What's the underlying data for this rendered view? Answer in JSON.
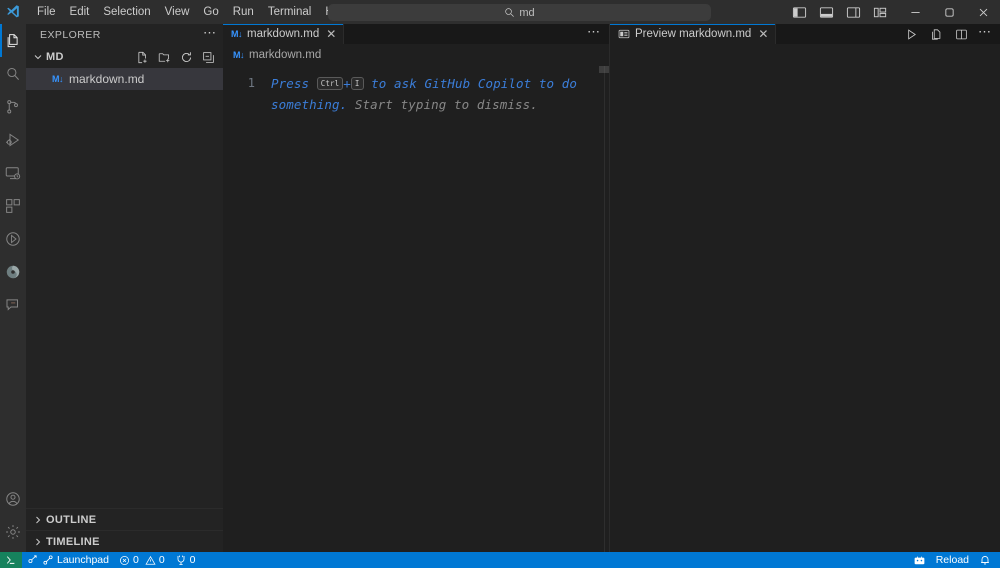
{
  "titlebar": {
    "logo_name": "vscode-logo",
    "menus": [
      "File",
      "Edit",
      "Selection",
      "View",
      "Go",
      "Run",
      "Terminal",
      "Help"
    ],
    "nav_back": "back-arrow",
    "nav_forward": "forward-arrow",
    "command_center": {
      "icon": "search-icon",
      "value": "md",
      "placeholder": "Search"
    },
    "layout_controls": [
      {
        "name": "toggle-primary-sidebar",
        "label": "Toggle Primary Side Bar"
      },
      {
        "name": "toggle-panel",
        "label": "Toggle Panel"
      },
      {
        "name": "toggle-secondary-sidebar",
        "label": "Toggle Secondary Side Bar"
      },
      {
        "name": "customize-layout",
        "label": "Customize Layout"
      }
    ],
    "window_controls": [
      {
        "name": "minimize-button",
        "glyph": "–"
      },
      {
        "name": "maximize-button",
        "glyph": "▢"
      },
      {
        "name": "close-button",
        "glyph": "×"
      }
    ]
  },
  "activitybar": {
    "items": [
      {
        "name": "explorer",
        "label": "Explorer",
        "active": true
      },
      {
        "name": "search",
        "label": "Search",
        "active": false
      },
      {
        "name": "source-control",
        "label": "Source Control",
        "active": false
      },
      {
        "name": "run-and-debug",
        "label": "Run and Debug",
        "active": false
      },
      {
        "name": "remote-explorer",
        "label": "Remote Explorer",
        "active": false
      },
      {
        "name": "extensions",
        "label": "Extensions",
        "active": false
      },
      {
        "name": "testing",
        "label": "Testing",
        "active": false
      },
      {
        "name": "copilot",
        "label": "GitHub Copilot",
        "active": false
      },
      {
        "name": "chat",
        "label": "Chat",
        "active": false
      }
    ],
    "bottom": [
      {
        "name": "accounts",
        "label": "Accounts"
      },
      {
        "name": "manage-settings",
        "label": "Manage"
      }
    ]
  },
  "sidebar": {
    "title": "EXPLORER",
    "more_actions": "⋯",
    "folder": {
      "name": "MD",
      "actions": [
        {
          "name": "new-file-button",
          "label": "New File..."
        },
        {
          "name": "new-folder-button",
          "label": "New Folder..."
        },
        {
          "name": "refresh-explorer-button",
          "label": "Refresh Explorer"
        },
        {
          "name": "collapse-folders-button",
          "label": "Collapse Folders in Explorer"
        }
      ],
      "files": [
        {
          "name": "markdown.md",
          "badge": "M↓",
          "selected": true
        }
      ]
    },
    "sections": [
      {
        "name": "outline",
        "label": "OUTLINE"
      },
      {
        "name": "timeline",
        "label": "TIMELINE"
      }
    ]
  },
  "editor_group_left": {
    "tab": {
      "label": "markdown.md",
      "badge": "M↓",
      "close_glyph": "✕",
      "active": true
    },
    "more_actions": "⋯",
    "breadcrumb": {
      "badge": "M↓",
      "label": "markdown.md"
    },
    "content": {
      "line_number": "1",
      "ghost_segments": [
        {
          "text": "Press ",
          "color": "blue"
        },
        {
          "key": "Ctrl"
        },
        {
          "text": "+",
          "color": "blue"
        },
        {
          "key": "I"
        },
        {
          "text": " to ask GitHub Copilot to do something.",
          "color": "blue"
        },
        {
          "text": " Start typing to dismiss.",
          "color": "gray"
        }
      ],
      "full_text": "Press Ctrl+I to ask GitHub Copilot to do something. Start typing to dismiss."
    }
  },
  "editor_group_right": {
    "tab": {
      "label": "Preview markdown.md",
      "icon": "preview-icon",
      "close_glyph": "✕",
      "active": true
    },
    "actions": [
      {
        "name": "run-button",
        "label": "Run"
      },
      {
        "name": "open-preview-to-side-button",
        "label": "Open Preview to the Side"
      },
      {
        "name": "split-editor-button",
        "label": "Split Editor"
      },
      {
        "name": "more-actions-button",
        "label": "More Actions..."
      }
    ]
  },
  "statusbar": {
    "remote": {
      "name": "remote-host-indicator",
      "label": ""
    },
    "left_items": [
      {
        "name": "launchpad",
        "label": "Launchpad"
      },
      {
        "name": "problems",
        "errors": "0",
        "warnings": "0"
      },
      {
        "name": "ports",
        "label": "0"
      }
    ],
    "right_items": [
      {
        "name": "extension-update",
        "label": "Reload"
      },
      {
        "name": "notifications",
        "label": ""
      }
    ]
  },
  "colors": {
    "accent": "#0078d4",
    "remote_green": "#16825d",
    "titlebar_bg": "#2e2e2e",
    "sidebar_bg": "#232323",
    "editor_bg": "#1f1f1f",
    "ghost_blue": "#3b7dd8",
    "ghost_gray": "#878787",
    "md_badge": "#3794ff"
  }
}
